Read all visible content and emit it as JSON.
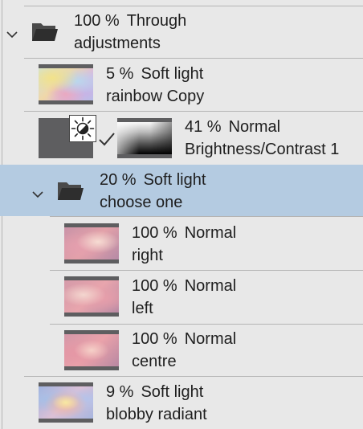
{
  "layers": [
    {
      "id": "adjustments",
      "opacity": "100 %",
      "mode": "Through",
      "name": "adjustments",
      "kind": "group",
      "expanded": true,
      "selected": false
    },
    {
      "id": "rainbow-copy",
      "opacity": "5 %",
      "mode": "Soft light",
      "name": "rainbow Copy",
      "kind": "pixel",
      "thumb": "rainbow",
      "selected": false
    },
    {
      "id": "brightness-contrast",
      "opacity": "41 %",
      "mode": "Normal",
      "name": "Brightness/Contrast 1",
      "kind": "adjustment",
      "visible_check": true,
      "selected": false
    },
    {
      "id": "choose-one",
      "opacity": "20 %",
      "mode": "Soft light",
      "name": "choose one",
      "kind": "group",
      "expanded": true,
      "selected": true
    },
    {
      "id": "right",
      "opacity": "100 %",
      "mode": "Normal",
      "name": "right",
      "kind": "pixel",
      "thumb": "right",
      "selected": false
    },
    {
      "id": "left",
      "opacity": "100 %",
      "mode": "Normal",
      "name": "left",
      "kind": "pixel",
      "thumb": "left",
      "selected": false
    },
    {
      "id": "centre",
      "opacity": "100 %",
      "mode": "Normal",
      "name": "centre",
      "kind": "pixel",
      "thumb": "centre",
      "selected": false
    },
    {
      "id": "blobby-radiant",
      "opacity": "9 %",
      "mode": "Soft light",
      "name": "blobby radiant",
      "kind": "pixel",
      "thumb": "blobby",
      "selected": false
    }
  ],
  "colors": {
    "panel_background": "#e8e8e8",
    "selected_row": "#b4cbe1",
    "separator": "#b4b4b4",
    "text": "#1e1e1e"
  },
  "icons": {
    "group_expand": "chevron-down-icon",
    "group": "folder-icon",
    "adjustment": "brightness-contrast-icon",
    "link": "checkmark-icon"
  }
}
